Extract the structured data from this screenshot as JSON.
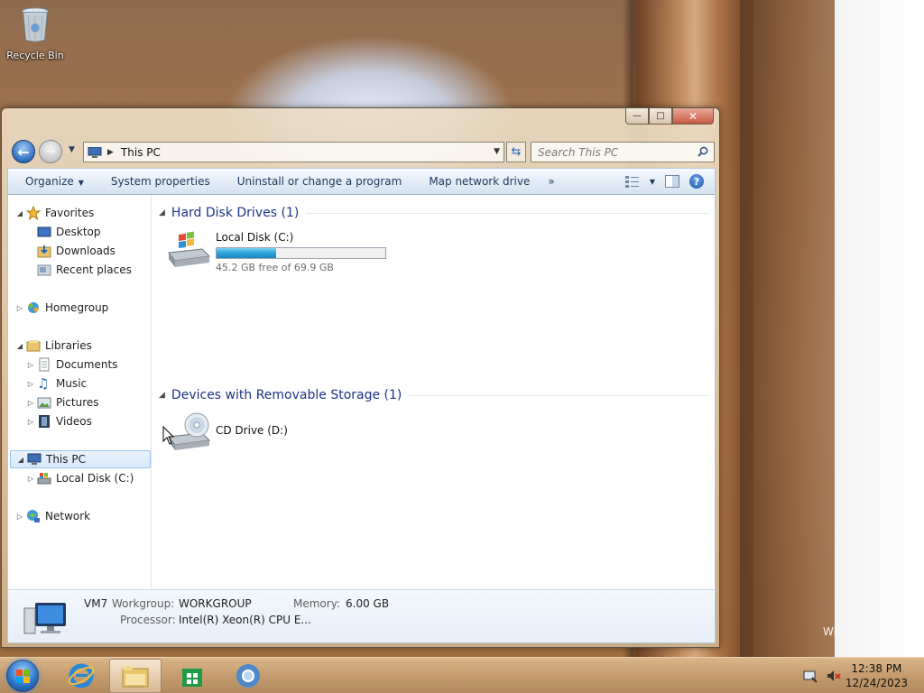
{
  "desktop": {
    "recycle_bin_label": "Recycle Bin",
    "watermark": "Wi"
  },
  "window": {
    "caption_buttons": {
      "minimize": "—",
      "maximize": "□",
      "close": "✕"
    },
    "address": {
      "path": "This PC"
    },
    "search": {
      "placeholder": "Search This PC"
    },
    "toolbar": {
      "organize": "Organize",
      "system_properties": "System properties",
      "uninstall": "Uninstall or change a program",
      "map_drive": "Map network drive",
      "more": "»",
      "help": "?"
    },
    "nav": {
      "favorites": "Favorites",
      "desktop": "Desktop",
      "downloads": "Downloads",
      "recent": "Recent places",
      "homegroup": "Homegroup",
      "libraries": "Libraries",
      "documents": "Documents",
      "music": "Music",
      "pictures": "Pictures",
      "videos": "Videos",
      "this_pc": "This PC",
      "local_disk": "Local Disk (C:)",
      "network": "Network"
    },
    "content": {
      "hdd_header": "Hard Disk Drives (1)",
      "removable_header": "Devices with Removable Storage (1)",
      "drive_c": {
        "name": "Local Disk (C:)",
        "free_text": "45.2 GB free of 69.9 GB",
        "used_fraction": 0.353
      },
      "drive_d": {
        "name": "CD Drive (D:)"
      }
    },
    "details": {
      "computer_name": "VM7",
      "workgroup_label": "Workgroup:",
      "workgroup_value": "WORKGROUP",
      "memory_label": "Memory:",
      "memory_value": "6.00 GB",
      "processor_label": "Processor:",
      "processor_value": "Intel(R) Xeon(R) CPU E..."
    }
  },
  "taskbar": {
    "time": "12:38 PM",
    "date": "12/24/2023"
  },
  "colors": {
    "accent_blue": "#1e3287",
    "usage_bar": "#2ca6d9",
    "command_bar": "#e3edf7"
  }
}
